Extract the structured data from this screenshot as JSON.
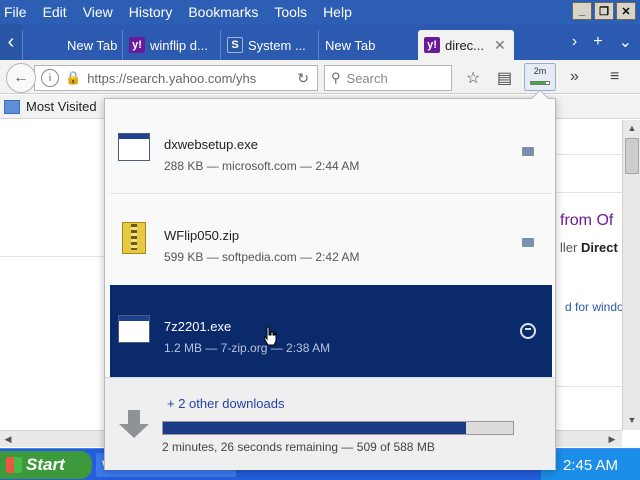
{
  "menubar": {
    "items": [
      "File",
      "Edit",
      "View",
      "History",
      "Bookmarks",
      "Tools",
      "Help"
    ]
  },
  "tabs": [
    {
      "label": "New Tab",
      "favicon": "none"
    },
    {
      "label": "winflip d...",
      "favicon": "yahoo-icon"
    },
    {
      "label": "System ...",
      "favicon": "s-icon"
    },
    {
      "label": "New Tab",
      "favicon": "none"
    },
    {
      "label": "direc...",
      "favicon": "yahoo-icon",
      "active": true
    }
  ],
  "navbar": {
    "url": "https://search.yahoo.com/yhs",
    "search_placeholder": "Search",
    "download_time": "2m",
    "download_progress": 0.86
  },
  "bookmarks": {
    "most_visited": "Most Visited"
  },
  "page": {
    "heading": "from Of",
    "sub_prefix": "ller",
    "sub_bold": "Direct",
    "link": "d for windov"
  },
  "downloads": {
    "items": [
      {
        "name": "dxwebsetup.exe",
        "meta": "288 KB — microsoft.com — 2:44 AM",
        "type": "exe"
      },
      {
        "name": "WFlip050.zip",
        "meta": "599 KB — softpedia.com — 2:42 AM",
        "type": "zip"
      },
      {
        "name": "7z2201.exe",
        "meta": "1.2 MB — 7-zip.org — 2:38 AM",
        "type": "exe",
        "selected": true
      }
    ],
    "others": "+ 2 other downloads",
    "status": "2 minutes, 26 seconds remaining — 509 of 588 MB",
    "progress": 0.866
  },
  "taskbar": {
    "start": "Start",
    "task": "W",
    "clock": "2:45 AM"
  },
  "colors": {
    "menubar": "#2c5fb3",
    "selected_item": "#0b2a6b",
    "progress_fill": "#1b3b86",
    "link": "#2544a8"
  }
}
